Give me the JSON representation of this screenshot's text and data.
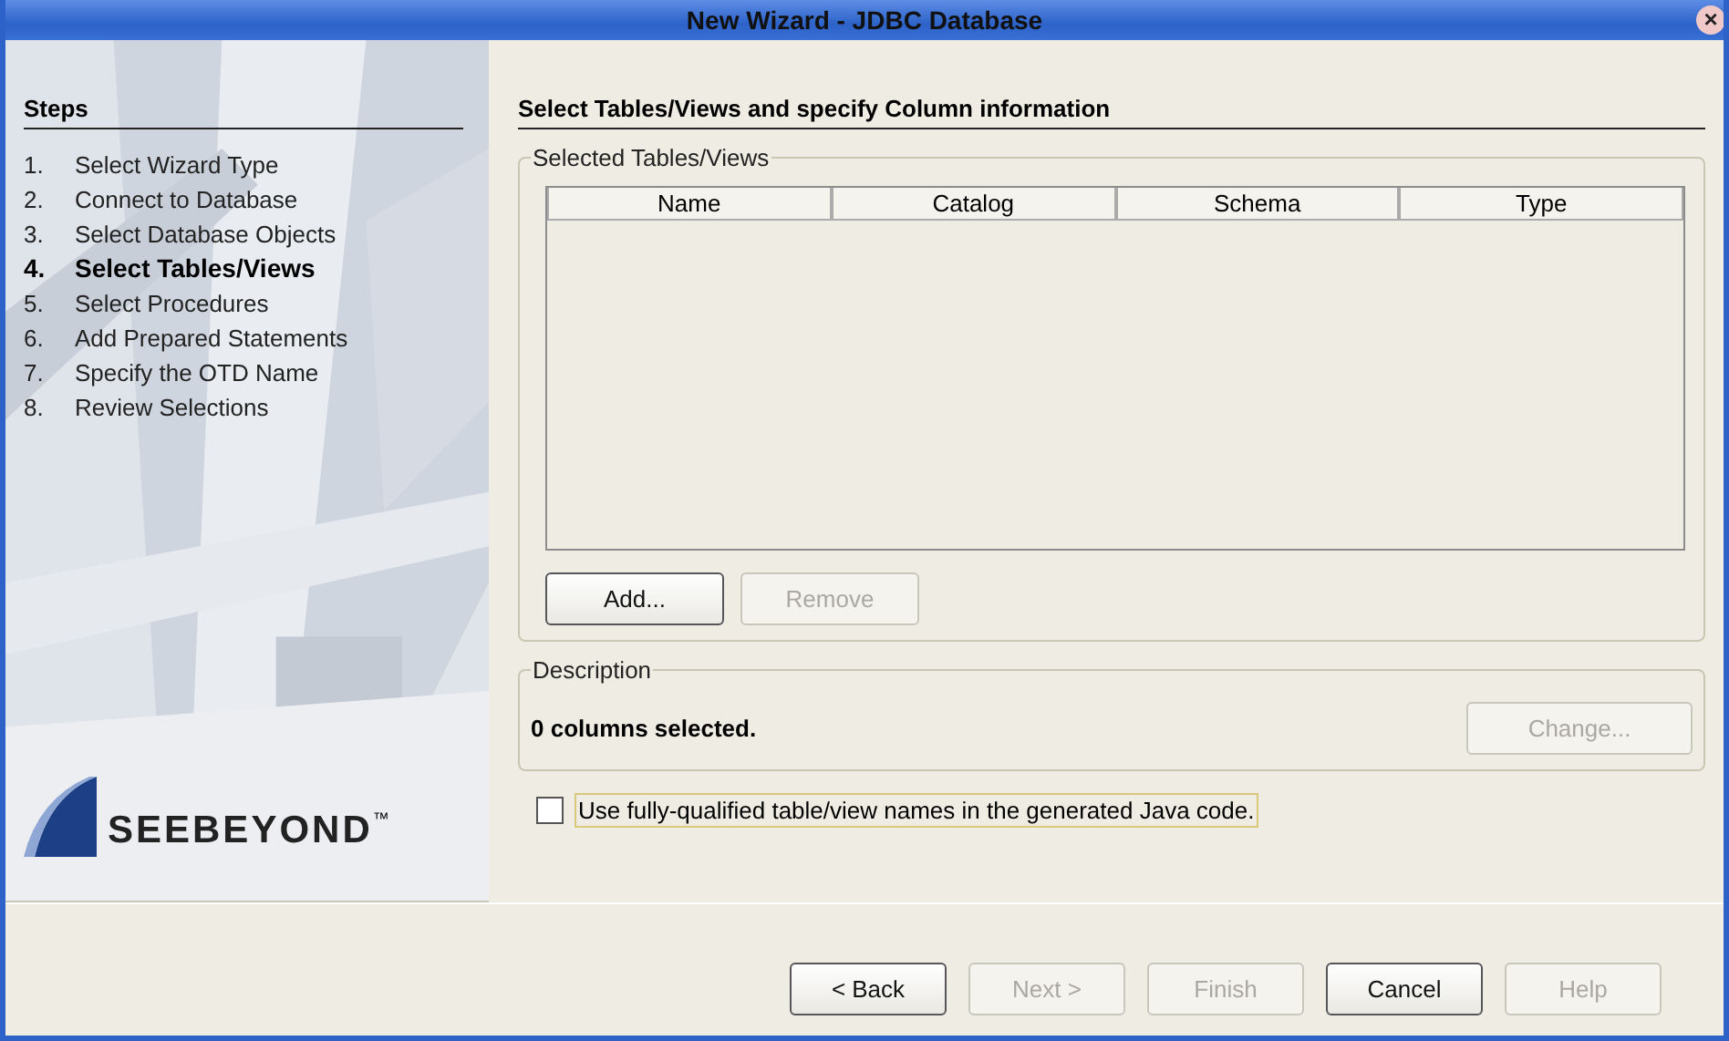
{
  "window": {
    "title": "New Wizard - JDBC Database",
    "close": "×"
  },
  "steps": {
    "title": "Steps",
    "items": [
      {
        "number": "1.",
        "label": "Select Wizard Type",
        "selected": false
      },
      {
        "number": "2.",
        "label": "Connect to Database",
        "selected": false
      },
      {
        "number": "3.",
        "label": "Select Database Objects",
        "selected": false
      },
      {
        "number": "4.",
        "label": "Select Tables/Views",
        "selected": true
      },
      {
        "number": "5.",
        "label": "Select Procedures",
        "selected": false
      },
      {
        "number": "6.",
        "label": "Add Prepared Statements",
        "selected": false
      },
      {
        "number": "7.",
        "label": "Specify the OTD Name",
        "selected": false
      },
      {
        "number": "8.",
        "label": "Review Selections",
        "selected": false
      }
    ]
  },
  "logo": {
    "name": "SEEBEYOND",
    "mark": "™"
  },
  "heading": "Select Tables/Views and specify Column information",
  "tables_group": {
    "title": "Selected Tables/Views",
    "columns": [
      "Name",
      "Catalog",
      "Schema",
      "Type"
    ],
    "buttons": [
      {
        "label": "Add...",
        "disabled": false
      },
      {
        "label": "Remove",
        "disabled": true
      }
    ]
  },
  "description_group": {
    "title": "Description",
    "text": "0 columns selected.",
    "button": {
      "label": "Change...",
      "disabled": true
    }
  },
  "qualified_names": {
    "label": "Use fully-qualified table/view names in the generated Java code.",
    "checked": false
  },
  "buttons": [
    {
      "label": "< Back",
      "disabled": false
    },
    {
      "label": "Next >",
      "disabled": true
    },
    {
      "label": "Finish",
      "disabled": true
    },
    {
      "label": "Cancel",
      "disabled": false
    },
    {
      "label": "Help",
      "disabled": true
    }
  ]
}
